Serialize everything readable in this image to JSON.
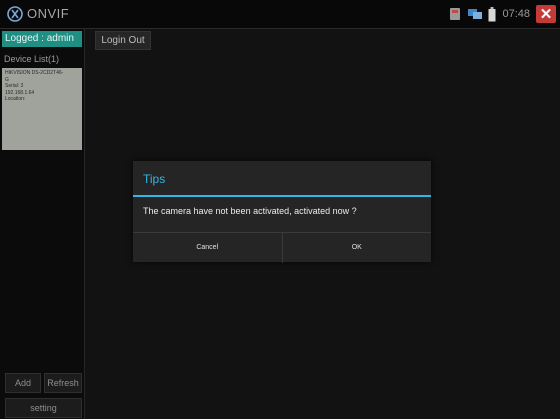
{
  "app": {
    "title": "ONVIF"
  },
  "status": {
    "time": "07:48"
  },
  "sidebar": {
    "logged_label": "Logged : admin",
    "device_list_title": "Device List(1)",
    "device": {
      "lines": [
        "HIKVISION DS-2CD2T46-",
        "G",
        "Serial: 3",
        "192.168.1.64",
        "Location:"
      ]
    },
    "add_label": "Add",
    "refresh_label": "Refresh",
    "setting_label": "setting"
  },
  "toolbar": {
    "login_out_label": "Login Out"
  },
  "dialog": {
    "title": "Tips",
    "message": "The camera have not been activated, activated now ?",
    "cancel_label": "Cancel",
    "ok_label": "OK"
  },
  "colors": {
    "accent": "#33b5e5",
    "logged_bg": "#1f8f84",
    "close_bg": "#c43a36"
  },
  "icons": [
    "onvif-logo-icon",
    "sd-card-icon",
    "network-icon",
    "battery-icon",
    "close-icon"
  ]
}
